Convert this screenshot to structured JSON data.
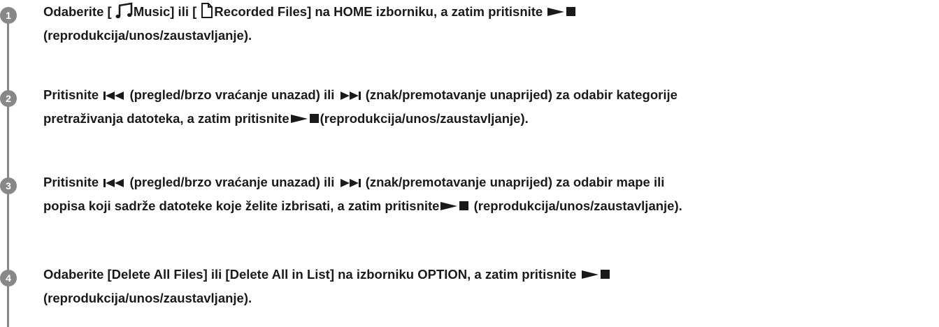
{
  "steps": [
    {
      "number": "1",
      "line1": {
        "a": "Odaberite [",
        "music_label": "Music",
        "b": "] ili [",
        "recorded_label": "Recorded Files",
        "c": "] na HOME izborniku, a zatim pritisnite"
      },
      "line2": "(reprodukcija/unos/zaustavljanje)."
    },
    {
      "number": "2",
      "line1": {
        "a": "Pritisnite",
        "b": "(pregled/brzo vraćanje unazad) ili",
        "c": "(znak/premotavanje unaprijed) za odabir kategorije"
      },
      "line2": {
        "a": "pretraživanja datoteka, a zatim pritisnite",
        "b": "(reprodukcija/unos/zaustavljanje)."
      }
    },
    {
      "number": "3",
      "line1": {
        "a": "Pritisnite",
        "b": "(pregled/brzo vraćanje unazad) ili",
        "c": "(znak/premotavanje unaprijed) za odabir mape ili"
      },
      "line2": {
        "a": "popisa koji sadrže datoteke koje želite izbrisati, a zatim pritisnite",
        "b": "(reprodukcija/unos/zaustavljanje)."
      }
    },
    {
      "number": "4",
      "line1": "Odaberite [Delete All Files] ili [Delete All in List] na izborniku OPTION, a zatim pritisnite",
      "line2": "(reprodukcija/unos/zaustavljanje)."
    }
  ],
  "icons": {
    "music": "music-note-icon",
    "recorded": "document-icon",
    "play_stop": "play-stop-icon",
    "prev": "previous-rewind-icon",
    "next": "next-fast-forward-icon"
  },
  "colors": {
    "text": "#1a1a1a",
    "step_circle": "#888888",
    "rail": "#888888"
  }
}
